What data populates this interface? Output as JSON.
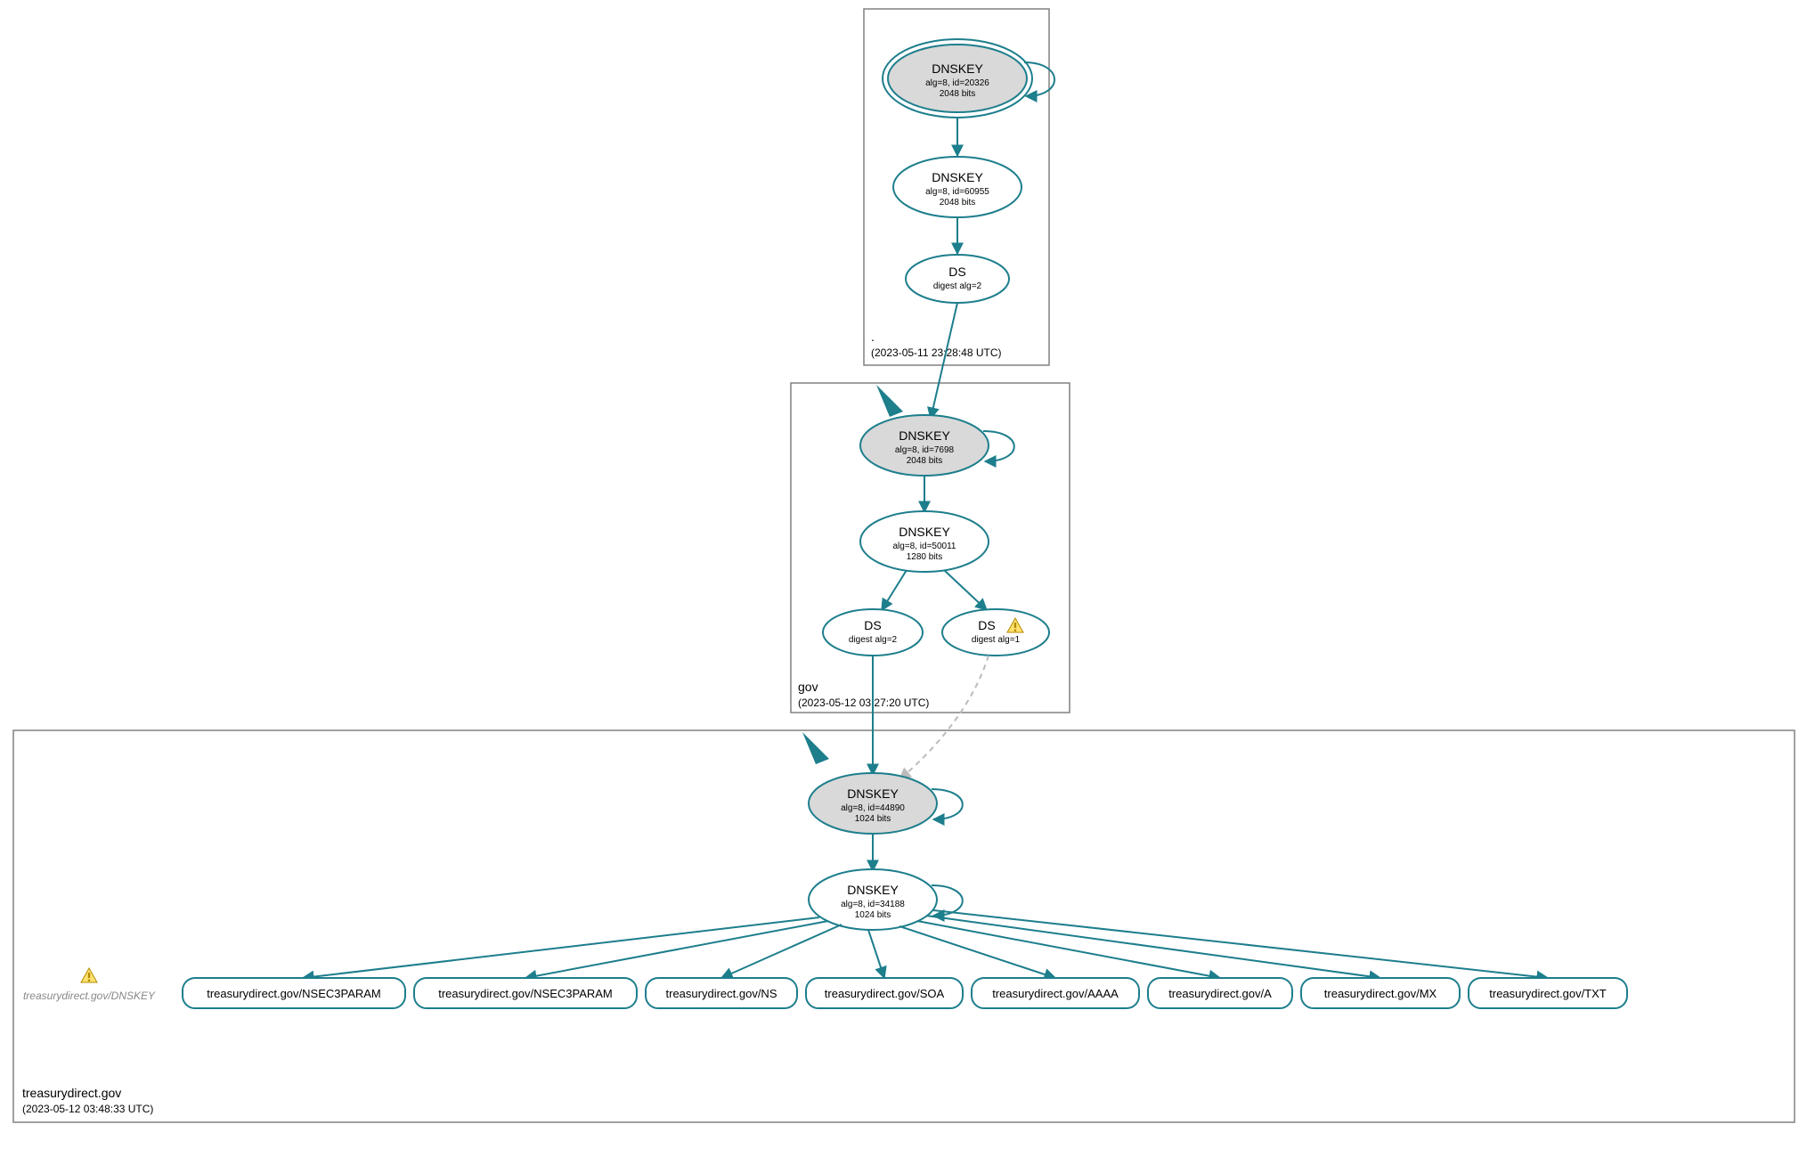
{
  "colors": {
    "teal": "#1d7e8c",
    "grey_fill": "#d9d9d9",
    "box_stroke": "#808080"
  },
  "zones": {
    "root": {
      "label": ".",
      "timestamp": "(2023-05-11 23:28:48 UTC)"
    },
    "gov": {
      "label": "gov",
      "timestamp": "(2023-05-12 03:27:20 UTC)"
    },
    "td": {
      "label": "treasurydirect.gov",
      "timestamp": "(2023-05-12 03:48:33 UTC)"
    }
  },
  "nodes": {
    "root_ksk": {
      "title": "DNSKEY",
      "line2": "alg=8, id=20326",
      "line3": "2048 bits"
    },
    "root_zsk": {
      "title": "DNSKEY",
      "line2": "alg=8, id=60955",
      "line3": "2048 bits"
    },
    "root_ds": {
      "title": "DS",
      "line2": "digest alg=2"
    },
    "gov_ksk": {
      "title": "DNSKEY",
      "line2": "alg=8, id=7698",
      "line3": "2048 bits"
    },
    "gov_zsk": {
      "title": "DNSKEY",
      "line2": "alg=8, id=50011",
      "line3": "1280 bits"
    },
    "gov_ds1": {
      "title": "DS",
      "line2": "digest alg=2"
    },
    "gov_ds2": {
      "title": "DS",
      "line2": "digest alg=1"
    },
    "td_ksk": {
      "title": "DNSKEY",
      "line2": "alg=8, id=44890",
      "line3": "1024 bits"
    },
    "td_zsk": {
      "title": "DNSKEY",
      "line2": "alg=8, id=34188",
      "line3": "1024 bits"
    },
    "td_missing": {
      "label": "treasurydirect.gov/DNSKEY"
    }
  },
  "rrs": [
    "treasurydirect.gov/NSEC3PARAM",
    "treasurydirect.gov/NSEC3PARAM",
    "treasurydirect.gov/NS",
    "treasurydirect.gov/SOA",
    "treasurydirect.gov/AAAA",
    "treasurydirect.gov/A",
    "treasurydirect.gov/MX",
    "treasurydirect.gov/TXT"
  ],
  "icons": {
    "warning": "warning-icon"
  }
}
